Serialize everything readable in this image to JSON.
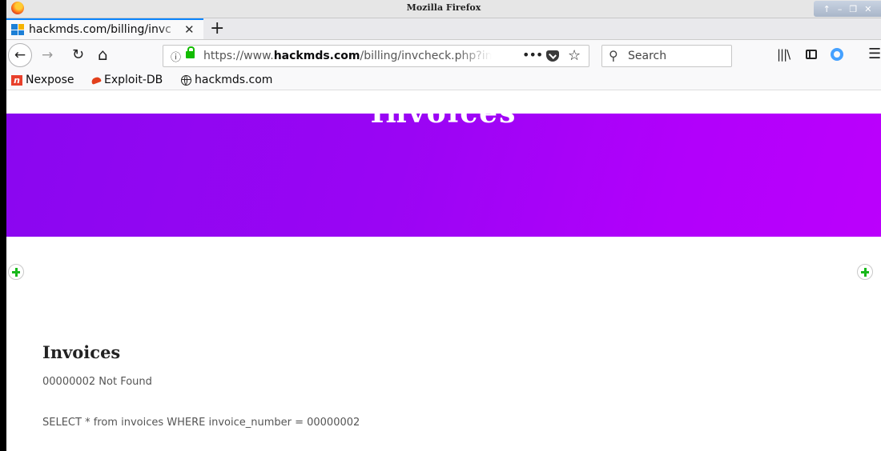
{
  "window": {
    "title": "Mozilla Firefox"
  },
  "tab": {
    "title": "hackmds.com/billing/invc"
  },
  "address_bar": {
    "url_prefix": "https://www.",
    "url_domain": "hackmds.com",
    "url_path": "/billing/invcheck.php?in"
  },
  "search_bar": {
    "placeholder": "Search"
  },
  "bookmarks": [
    {
      "label": "Nexpose",
      "icon": "nexpose-icon"
    },
    {
      "label": "Exploit-DB",
      "icon": "exploit-db-icon"
    },
    {
      "label": "hackmds.com",
      "icon": "globe-icon"
    }
  ],
  "page": {
    "hero_title": "Invoices",
    "heading": "Invoices",
    "status_line": "00000002 Not Found",
    "query_line": "SELECT * from invoices WHERE invoice_number = 00000002"
  },
  "colors": {
    "hero_start": "#8a06f0",
    "hero_end": "#bb00fc",
    "accent": "#0a84ff",
    "lock": "#12bc00",
    "plus": "#17b81a"
  }
}
